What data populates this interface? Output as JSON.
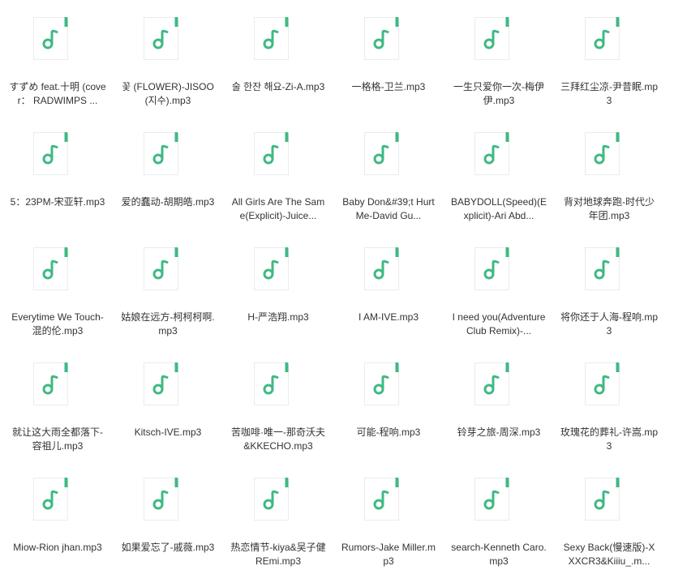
{
  "colors": {
    "icon_accent": "#3fb983",
    "icon_body": "#ffffff",
    "icon_border": "#e9ebee",
    "label_text": "#333333"
  },
  "icon_name": "music-file-icon",
  "files": [
    "すずめ feat.十明 (cover： RADWIMPS ...",
    "꽃 (FLOWER)-JISOO (지수).mp3",
    "술 한잔 해요-Zi-A.mp3",
    "一格格-卫兰.mp3",
    "一生只爱你一次-梅伊伊.mp3",
    "三拜红尘凉-尹昔眠.mp3",
    "5：23PM-宋亚轩.mp3",
    "爱的蠢动-胡期皓.mp3",
    "All Girls Are The Same(Explicit)-Juice...",
    "Baby Don&#39;t Hurt Me-David Gu...",
    "BABYDOLL(Speed)(Explicit)-Ari Abd...",
    "背对地球奔跑-时代少年团.mp3",
    "Everytime We Touch-混的伦.mp3",
    "姑娘在远方-柯柯柯啊.mp3",
    "H-严浩翔.mp3",
    "I AM-IVE.mp3",
    "I need you(Adventure Club Remix)-...",
    "将你还于人海-程响.mp3",
    "就让这大雨全都落下-容祖儿.mp3",
    "Kitsch-IVE.mp3",
    "苦咖啡·唯一-那奇沃夫&KKECHO.mp3",
    "可能-程响.mp3",
    "铃芽之旅-周深.mp3",
    "玫瑰花的葬礼-许嵩.mp3",
    "Miow-Rion jhan.mp3",
    "如果爱忘了-戚薇.mp3",
    "热恋情节-kiya&吴子健REmi.mp3",
    "Rumors-Jake Miller.mp3",
    "search-Kenneth Caro.mp3",
    "Sexy Back(慢速版)-XXXCR3&Kiiiu_.m..."
  ]
}
